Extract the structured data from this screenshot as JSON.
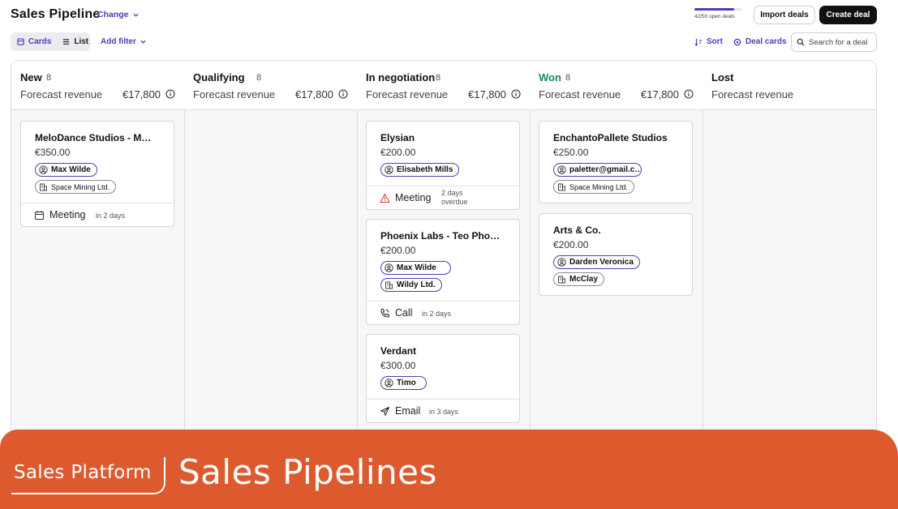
{
  "header": {
    "title": "Sales Pipeline",
    "change_label": "Change",
    "quota": {
      "label": "42/50 open deals",
      "used": 42,
      "total": 50
    },
    "import_label": "Import deals",
    "create_label": "Create deal"
  },
  "toolbar": {
    "views": [
      {
        "label": "Cards",
        "icon": "cards-icon",
        "active": true
      },
      {
        "label": "List",
        "icon": "list-icon",
        "active": false
      }
    ],
    "add_filter_label": "Add filter",
    "sort_label": "Sort",
    "deal_cards_label": "Deal cards",
    "search_placeholder": "Search for a deal"
  },
  "board": {
    "columns": [
      {
        "title": "New",
        "count": "8",
        "forecast_label": "Forecast revenue",
        "forecast_value": "€17,800",
        "cards": [
          {
            "name": "MeloDance Studios - Max…",
            "amount": "€350.00",
            "person": "Max Wilde",
            "company": "Space Mining Ltd.",
            "activity": {
              "type": "Meeting",
              "icon": "calendar-icon",
              "when": "in 2 days"
            }
          }
        ]
      },
      {
        "title": "Qualifying",
        "count": "8",
        "forecast_label": "Forecast revenue",
        "forecast_value": "€17,800",
        "cards": []
      },
      {
        "title": "In negotiation",
        "count": "8",
        "forecast_label": "Forecast revenue",
        "forecast_value": "€17,800",
        "cards": [
          {
            "name": "Elysian",
            "amount": "€200.00",
            "person": "Elisabeth Mills",
            "activity": {
              "type": "Meeting",
              "icon": "warning-icon",
              "when_line1": "2 days",
              "when_line2": "overdue"
            }
          },
          {
            "name": "Phoenix Labs - Teo Phoe…",
            "amount": "€200.00",
            "person": "Max Wilde",
            "company": "Wildy Ltd.",
            "activity": {
              "type": "Call",
              "icon": "phone-icon",
              "when": "in 2 days"
            }
          },
          {
            "name": "Verdant",
            "amount": "€300.00",
            "person": "Timo",
            "activity": {
              "type": "Email",
              "icon": "send-icon",
              "when": "in 3 days"
            }
          }
        ]
      },
      {
        "title": "Won",
        "count": "8",
        "forecast_label": "Forecast revenue",
        "forecast_value": "€17,800",
        "cards": [
          {
            "name": "EnchantoPallete Studios",
            "amount": "€250.00",
            "person": "paletter@gmail.c…",
            "company": "Space Mining Ltd."
          },
          {
            "name": "Arts & Co.",
            "amount": "€200.00",
            "person": "Darden Veronica",
            "company": "McClay"
          }
        ]
      },
      {
        "title": "Lost",
        "forecast_label": "Forecast revenue",
        "cards": []
      }
    ]
  },
  "banner": {
    "brand": "Sales Platform",
    "title": "Sales Pipelines"
  },
  "colors": {
    "accent": "#4b3fb5",
    "won": "#1a8a5a",
    "banner": "#dd5a2e"
  }
}
